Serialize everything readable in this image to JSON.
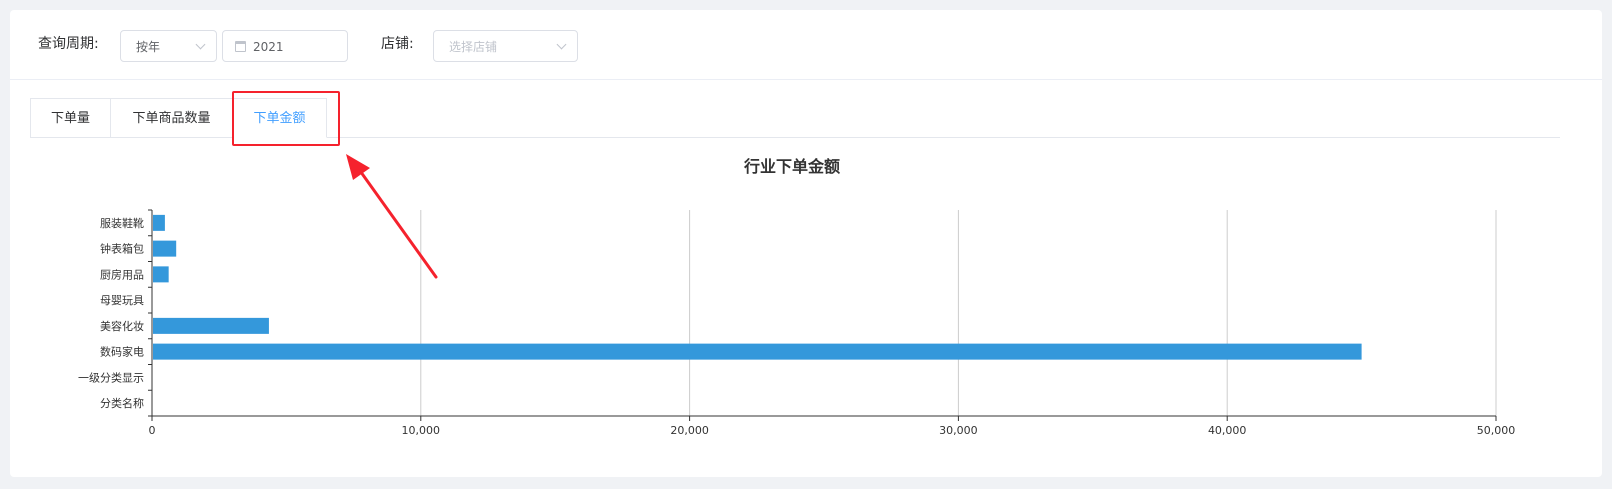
{
  "filters": {
    "period_label": "查询周期:",
    "period_type": "按年",
    "year": "2021",
    "store_label": "店铺:",
    "store_placeholder": "选择店铺"
  },
  "tabs": [
    {
      "label": "下单量",
      "active": false
    },
    {
      "label": "下单商品数量",
      "active": false
    },
    {
      "label": "下单金额",
      "active": true
    }
  ],
  "colors": {
    "accent": "#409eff",
    "bar": "#3498db",
    "annotation": "#f5222d"
  },
  "chart_data": {
    "type": "bar",
    "orientation": "horizontal",
    "title": "行业下单金额",
    "categories": [
      "服装鞋靴",
      "钟表箱包",
      "厨房用品",
      "母婴玩具",
      "美容化妆",
      "数码家电",
      "一级分类显示",
      "分类名称"
    ],
    "values": [
      480,
      900,
      620,
      0,
      4350,
      45000,
      0,
      0
    ],
    "xlim": [
      0,
      50000
    ],
    "xticks": [
      "0",
      "10,000",
      "20,000",
      "30,000",
      "40,000",
      "50,000"
    ],
    "xtick_values": [
      0,
      10000,
      20000,
      30000,
      40000,
      50000
    ],
    "grid": true,
    "series": [
      {
        "values": [
          480,
          900,
          620,
          0,
          4350,
          45000,
          0,
          0
        ]
      }
    ]
  }
}
